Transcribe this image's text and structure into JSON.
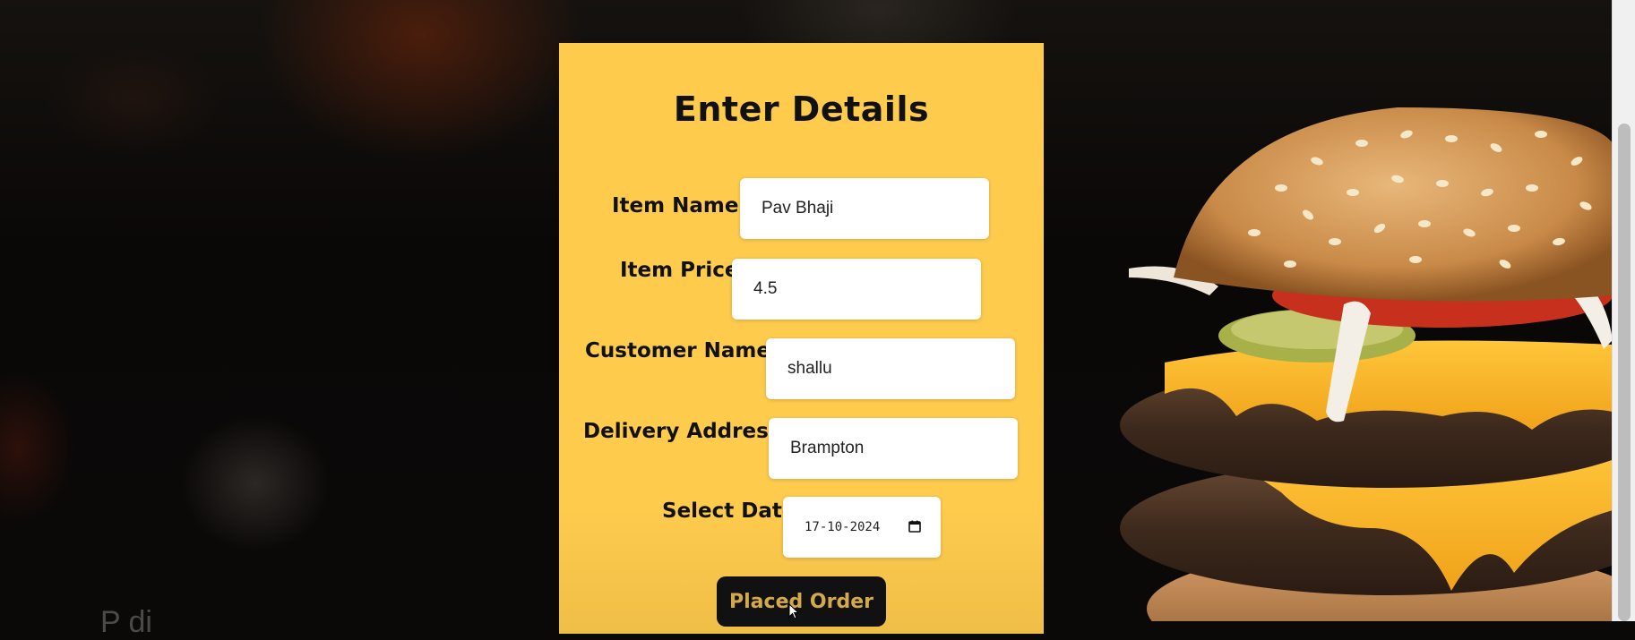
{
  "form": {
    "title": "Enter Details",
    "fields": [
      {
        "label": "Item Name:",
        "value": "Pav Bhaji"
      },
      {
        "label": "Item Price:",
        "value": "4.5"
      },
      {
        "label": "Customer Name:",
        "value": "shallu"
      },
      {
        "label": "Delivery Address:",
        "value": "Brampton"
      }
    ],
    "date": {
      "label": "Select Date",
      "value": "17-10-2024"
    },
    "submit_label": "Placed Order"
  },
  "background": {
    "partial_text": "P        di"
  },
  "icons": {
    "calendar": "calendar-icon",
    "cursor": "mouse-pointer-icon",
    "hero": "burger-image"
  },
  "colors": {
    "panel": "#fecb4d",
    "button_bg": "#111111",
    "button_text": "#d4a94a"
  }
}
